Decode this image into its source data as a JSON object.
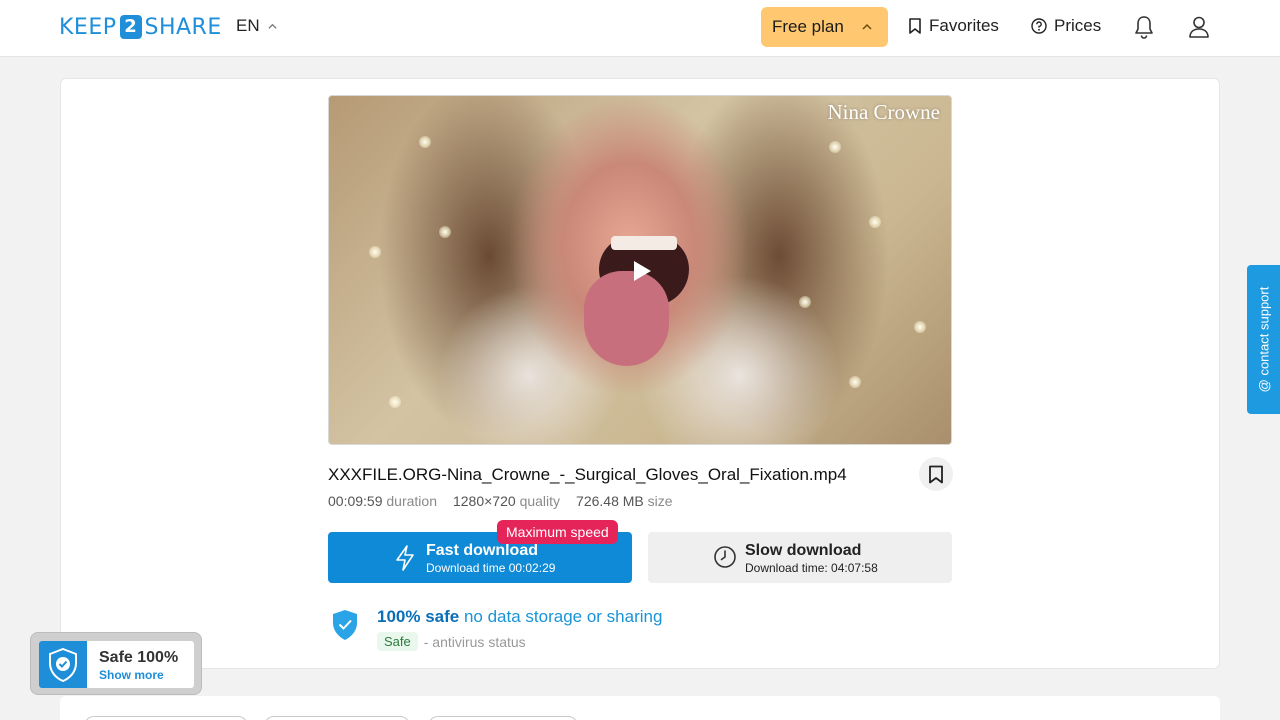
{
  "header": {
    "logo_left": "KEEP",
    "logo_num": "2",
    "logo_right": "SHARE",
    "language": "EN",
    "plan_label": "Free plan",
    "favorites_label": "Favorites",
    "prices_label": "Prices"
  },
  "video": {
    "watermark": "Nina Crowne"
  },
  "file": {
    "name": "XXXFILE.ORG-Nina_Crowne_-_Surgical_Gloves_Oral_Fixation.mp4",
    "duration_value": "00:09:59",
    "duration_label": "duration",
    "quality_value": "1280×720",
    "quality_label": "quality",
    "size_value": "726.48 MB",
    "size_label": "size"
  },
  "download": {
    "badge": "Maximum speed",
    "fast_title": "Fast download",
    "fast_time": "Download time 00:02:29",
    "slow_title": "Slow download",
    "slow_time": "Download time: 04:07:58"
  },
  "safety": {
    "safe_strong": "100% safe",
    "safe_rest": "no data storage or sharing",
    "tag": "Safe",
    "antivirus": "- antivirus status"
  },
  "widget": {
    "title": "Safe 100%",
    "link": "Show more"
  },
  "support": {
    "label": "@ contact support"
  },
  "colors": {
    "brand": "#1e8fd8",
    "plan": "#ffc870",
    "fast": "#0e8ad6",
    "badge": "#e5245a"
  }
}
